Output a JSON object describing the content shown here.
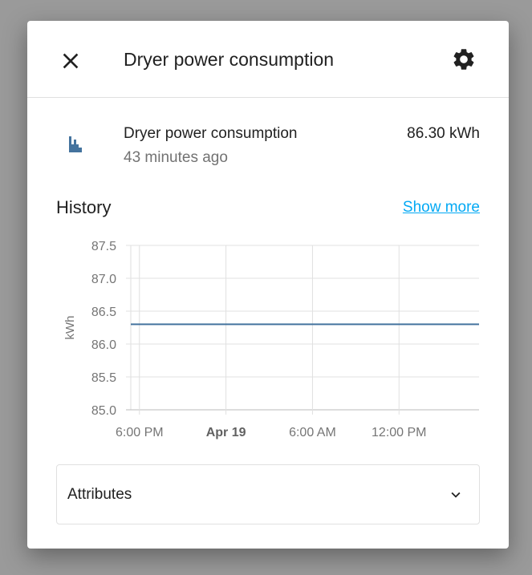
{
  "dialog": {
    "title": "Dryer power consumption"
  },
  "entity": {
    "name": "Dryer power consumption",
    "last_changed": "43 minutes ago",
    "state": "86.30 kWh"
  },
  "history": {
    "heading": "History",
    "show_more": "Show more"
  },
  "attributes": {
    "label": "Attributes"
  },
  "icons": {
    "close": "close-icon",
    "settings": "gear-icon",
    "entity": "chart-histogram-icon",
    "expand": "chevron-down-icon"
  },
  "colors": {
    "series": "#44739e",
    "link": "#03a9f4"
  },
  "chart_data": {
    "type": "line",
    "ylabel": "kWh",
    "ylim": [
      85.0,
      87.5
    ],
    "yticks": [
      "87.5",
      "87.0",
      "86.5",
      "86.0",
      "85.5",
      "85.0"
    ],
    "xunit": "hours since 6:00 PM Apr 18",
    "xlim": [
      -0.6,
      23.55
    ],
    "xticks": [
      {
        "x": 0,
        "label": "6:00 PM",
        "bold": false
      },
      {
        "x": 6,
        "label": "Apr 19",
        "bold": true
      },
      {
        "x": 12,
        "label": "6:00 AM",
        "bold": false
      },
      {
        "x": 18,
        "label": "12:00 PM",
        "bold": false
      }
    ],
    "series": [
      {
        "name": "Dryer power consumption",
        "x": [
          -0.6,
          23.55
        ],
        "y": [
          86.3,
          86.3
        ]
      }
    ],
    "grid": true
  }
}
